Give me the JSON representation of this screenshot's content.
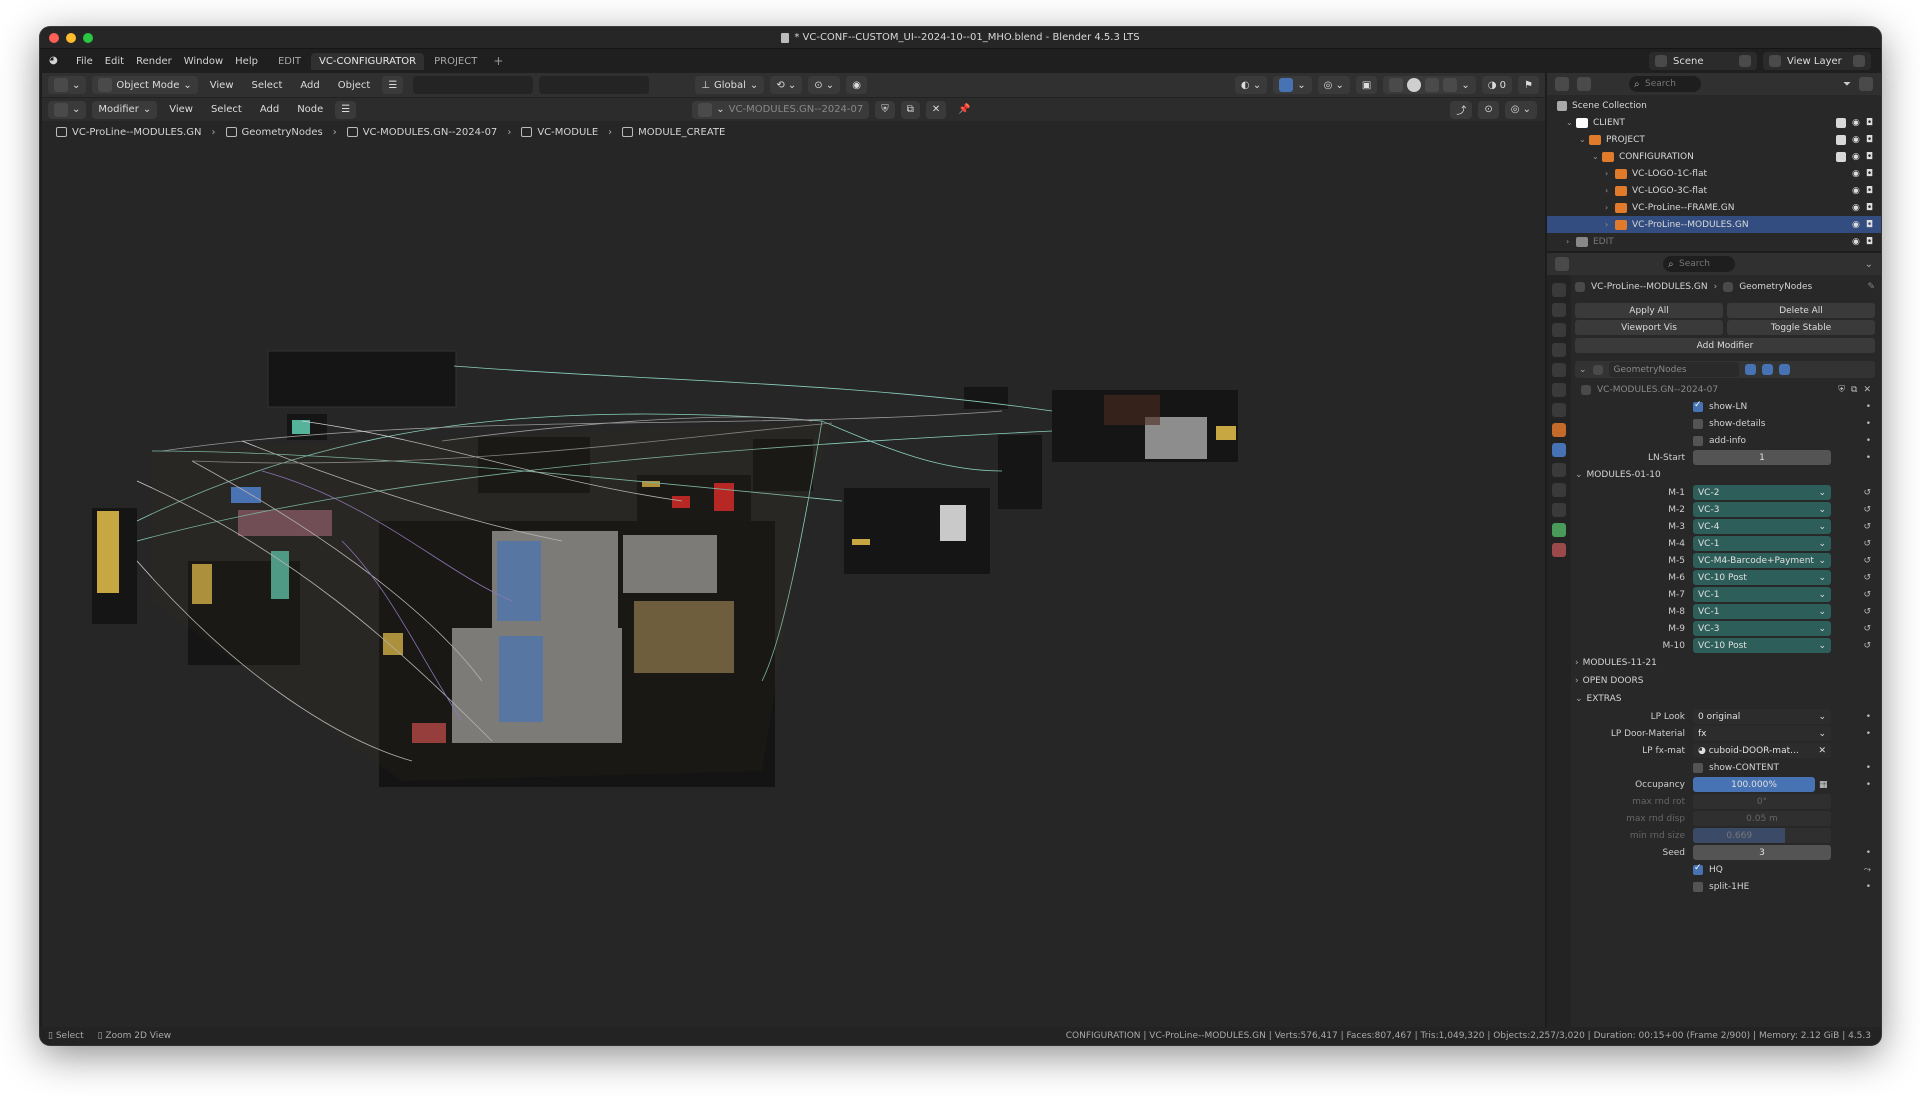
{
  "window": {
    "title": "* VC-CONF--CUSTOM_UI--2024-10--01_MHO.blend - Blender 4.5.3 LTS",
    "traffic_colors": [
      "#ff5f57",
      "#febc2e",
      "#28c840"
    ]
  },
  "menubar": {
    "items": [
      "File",
      "Edit",
      "Render",
      "Window",
      "Help"
    ],
    "workspaces": [
      "EDIT",
      "VC-CONFIGURATOR",
      "PROJECT"
    ],
    "add": "+",
    "scene": "Scene",
    "view_layer": "View Layer"
  },
  "viewport_header": {
    "mode": "Object Mode",
    "menus": [
      "View",
      "Select",
      "Add",
      "Object"
    ],
    "transform": "Global"
  },
  "node_header": {
    "editor_type": "Modifier",
    "menus": [
      "View",
      "Select",
      "Add",
      "Node"
    ],
    "node_tree": "VC-MODULES.GN--2024-07"
  },
  "breadcrumb": [
    "VC-ProLine--MODULES.GN",
    "GeometryNodes",
    "VC-MODULES.GN--2024-07",
    "VC-MODULE",
    "MODULE_CREATE"
  ],
  "outliner": {
    "header": "Scene Collection",
    "search_placeholder": "Search",
    "rows": [
      {
        "label": "CLIENT",
        "indent": 1,
        "color": "#ffffff"
      },
      {
        "label": "PROJECT",
        "indent": 2,
        "color": "#e07b2b"
      },
      {
        "label": "CONFIGURATION",
        "indent": 3,
        "color": "#e07b2b"
      },
      {
        "label": "VC-LOGO-1C-flat",
        "indent": 4,
        "color": "#e07b2b"
      },
      {
        "label": "VC-LOGO-3C-flat",
        "indent": 4,
        "color": "#e07b2b"
      },
      {
        "label": "VC-ProLine--FRAME.GN",
        "indent": 4,
        "color": "#e07b2b"
      },
      {
        "label": "VC-ProLine--MODULES.GN",
        "indent": 4,
        "color": "#e07b2b",
        "selected": true
      },
      {
        "label": "EDIT",
        "indent": 1,
        "color": "#888888",
        "dim": true
      }
    ]
  },
  "properties": {
    "search_placeholder": "Search",
    "object": "VC-ProLine--MODULES.GN",
    "modifier": "GeometryNodes",
    "apply_all": "Apply All",
    "delete_all": "Delete All",
    "viewport_vis": "Viewport Vis",
    "toggle_stable": "Toggle Stable",
    "add_modifier": "Add Modifier",
    "modifier_name": "GeometryNodes",
    "node_group": "VC-MODULES.GN--2024-07",
    "show_ln": "show-LN",
    "show_details": "show-details",
    "add_info": "add-info",
    "ln_start_label": "LN-Start",
    "ln_start_value": "1",
    "panel_modules_01_10": "MODULES-01-10",
    "modules": [
      {
        "label": "M-1",
        "value": "VC-2"
      },
      {
        "label": "M-2",
        "value": "VC-3"
      },
      {
        "label": "M-3",
        "value": "VC-4"
      },
      {
        "label": "M-4",
        "value": "VC-1"
      },
      {
        "label": "M-5",
        "value": "VC-M4-Barcode+Payment"
      },
      {
        "label": "M-6",
        "value": "VC-10 Post"
      },
      {
        "label": "M-7",
        "value": "VC-1"
      },
      {
        "label": "M-8",
        "value": "VC-1"
      },
      {
        "label": "M-9",
        "value": "VC-3"
      },
      {
        "label": "M-10",
        "value": "VC-10 Post"
      }
    ],
    "panel_modules_11_21": "MODULES-11-21",
    "panel_open_doors": "OPEN DOORS",
    "panel_extras": "EXTRAS",
    "lp_look_label": "LP Look",
    "lp_look_value": "0 original",
    "lp_door_label": "LP Door-Material",
    "lp_door_value": "fx",
    "lp_fx_label": "LP fx-mat",
    "lp_fx_value": "cuboid-DOOR-mat...",
    "show_content": "show-CONTENT",
    "occupancy_label": "Occupancy",
    "occupancy_value": "100.000%",
    "max_rnd_rot_label": "max rnd rot",
    "max_rnd_rot_value": "0°",
    "max_rnd_disp_label": "max rnd disp",
    "max_rnd_disp_value": "0.05 m",
    "min_rnd_size_label": "min rnd size",
    "min_rnd_size_value": "0.669",
    "seed_label": "Seed",
    "seed_value": "3",
    "hq": "HQ",
    "split": "split-1HE"
  },
  "status": {
    "left_select": "Select",
    "left_zoom": "Zoom 2D View",
    "right": "CONFIGURATION | VC-ProLine--MODULES.GN | Verts:576,417 | Faces:807,467 | Tris:1,049,320 | Objects:2,257/3,020 | Duration: 00:15+00 (Frame 2/900) | Memory: 2.12 GiB | 4.5.3"
  }
}
